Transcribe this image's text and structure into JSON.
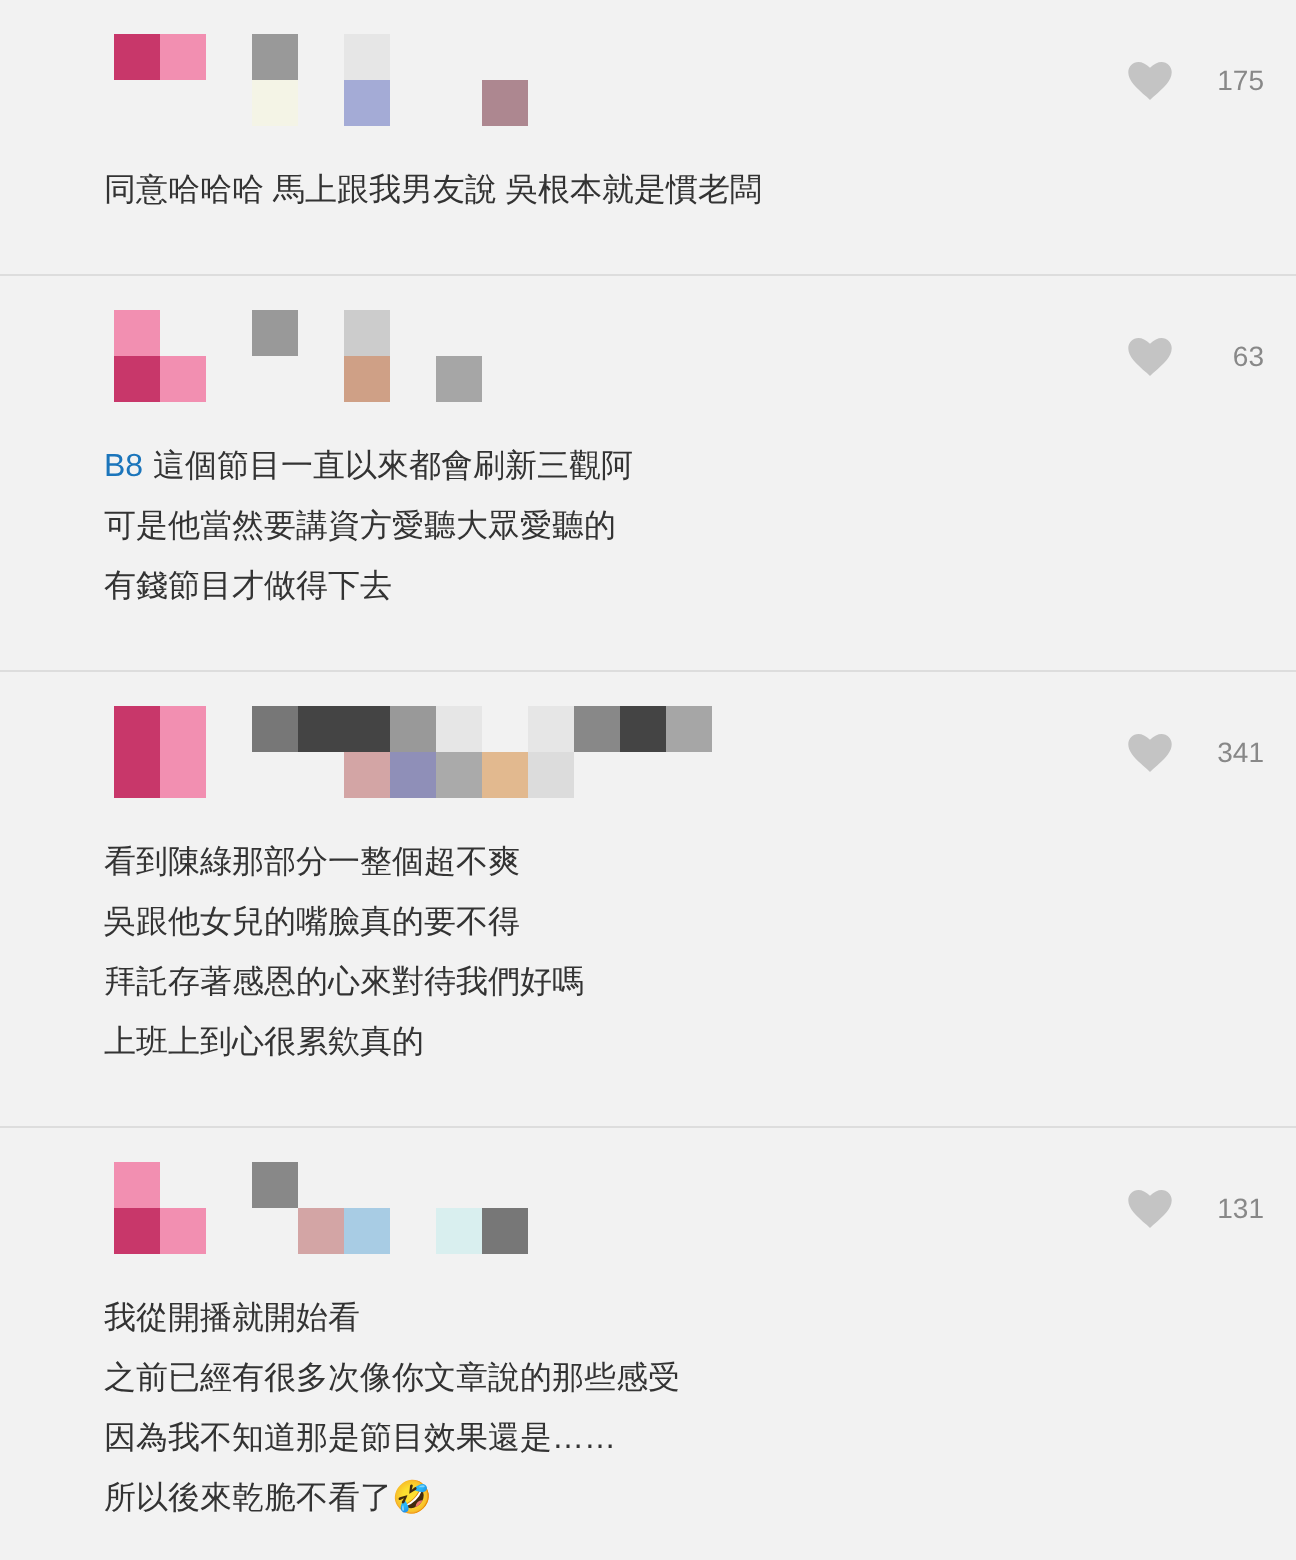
{
  "comments": [
    {
      "likes": "175",
      "lines": [
        {
          "text": "同意哈哈哈 馬上跟我男友說 吳根本就是慣老闆"
        }
      ]
    },
    {
      "likes": "63",
      "lines": [
        {
          "tag": "B8",
          "text": "這個節目一直以來都會刷新三觀阿"
        },
        {
          "text": "可是他當然要講資方愛聽大眾愛聽的"
        },
        {
          "text": "有錢節目才做得下去"
        }
      ]
    },
    {
      "likes": "341",
      "lines": [
        {
          "text": "看到陳綠那部分一整個超不爽"
        },
        {
          "text": "吳跟他女兒的嘴臉真的要不得"
        },
        {
          "text": "拜託存著感恩的心來對待我們好嗎"
        },
        {
          "text": "上班上到心很累欸真的"
        }
      ]
    },
    {
      "likes": "131",
      "lines": [
        {
          "text": "我從開播就開始看"
        },
        {
          "text": "之前已經有很多次像你文章說的那些感受"
        },
        {
          "text": "因為我不知道那是節目效果還是……"
        },
        {
          "text": "所以後來乾脆不看了🤣"
        }
      ]
    }
  ]
}
